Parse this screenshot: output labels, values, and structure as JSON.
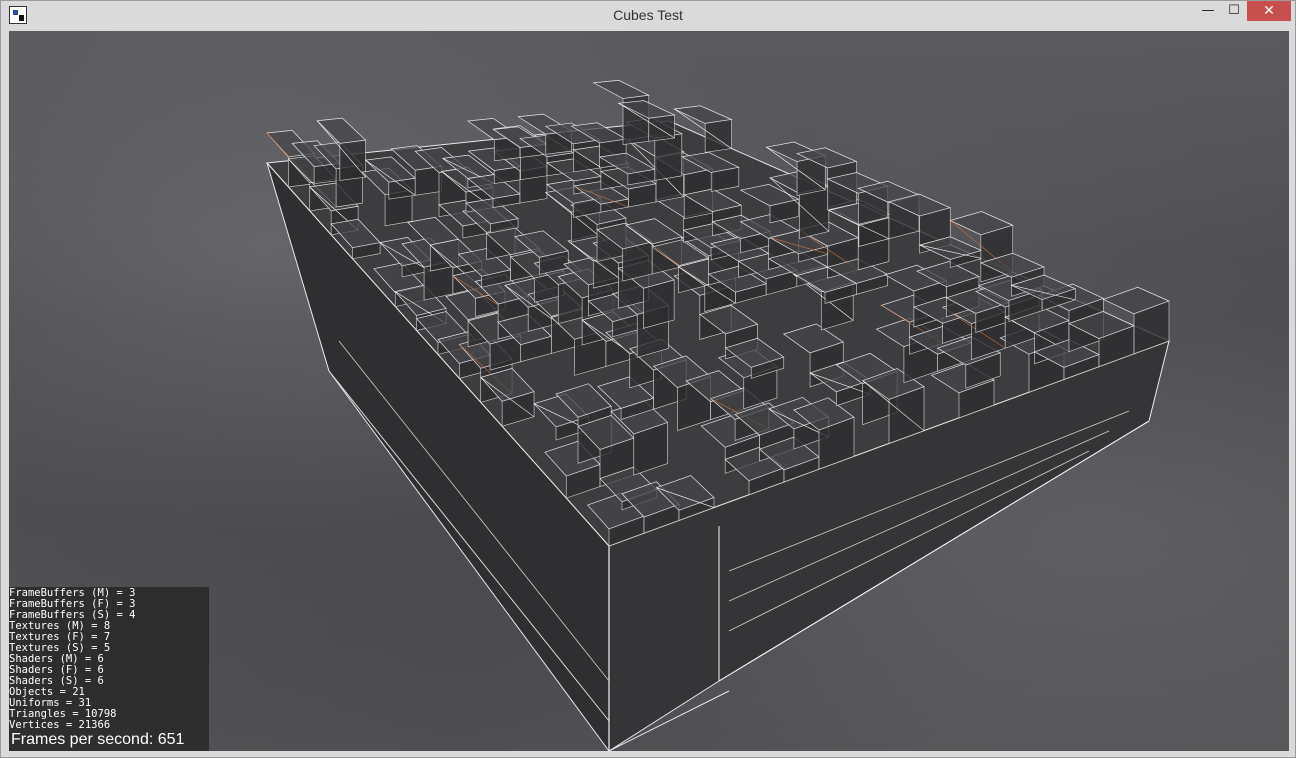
{
  "window": {
    "title": "Cubes Test",
    "controls": {
      "minimize": "—",
      "maximize": "☐",
      "close": "✕"
    }
  },
  "scene": {
    "description_icon": "wireframe-cubes-scene",
    "colors": {
      "wire": "#e8e8e8",
      "block": "#3a3a3c",
      "ground": "#505054"
    }
  },
  "stats": {
    "lines": [
      "FrameBuffers (M) = 3",
      "FrameBuffers (F) = 3",
      "FrameBuffers (S) = 4",
      "Textures (M) = 8",
      "Textures (F) = 7",
      "Textures (S) = 5",
      "Shaders (M) = 6",
      "Shaders (F) = 6",
      "Shaders (S) = 6",
      "Objects = 21",
      "Uniforms = 31",
      "Triangles = 10798",
      "Vertices = 21366"
    ],
    "fps": "Frames per second: 651"
  }
}
